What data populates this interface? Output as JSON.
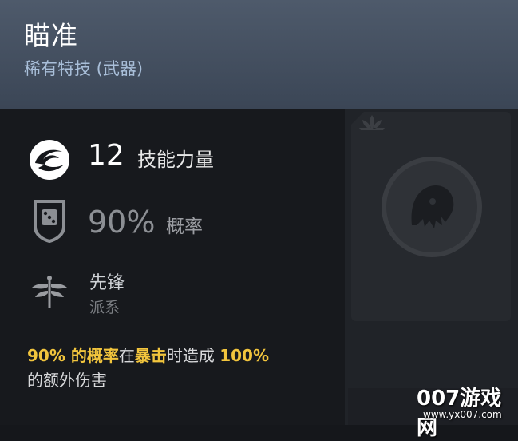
{
  "ability": {
    "title": "瞄准",
    "subtitle": "稀有特技 (武器)"
  },
  "stats": {
    "skill_power": {
      "value": "12",
      "label": "技能力量",
      "icon": "skill-power-icon"
    },
    "chance": {
      "value": "90%",
      "label": "概率",
      "icon": "dice-shield-icon"
    },
    "faction": {
      "name": "先锋",
      "label": "派系",
      "icon": "dragonfly-icon"
    }
  },
  "effect": {
    "part1": "90% 的概率",
    "part2": "在",
    "part3": "暴击",
    "part4": "时造成 ",
    "part5": "100%",
    "line2": "的额外伤害"
  },
  "watermark": {
    "logo": "007游戏网",
    "url": "www.yx007.com"
  },
  "colors": {
    "header": "#4e5a6b",
    "subtitle": "#a9bfd9",
    "highlight": "#f2c53d",
    "panel": "#17191d"
  }
}
